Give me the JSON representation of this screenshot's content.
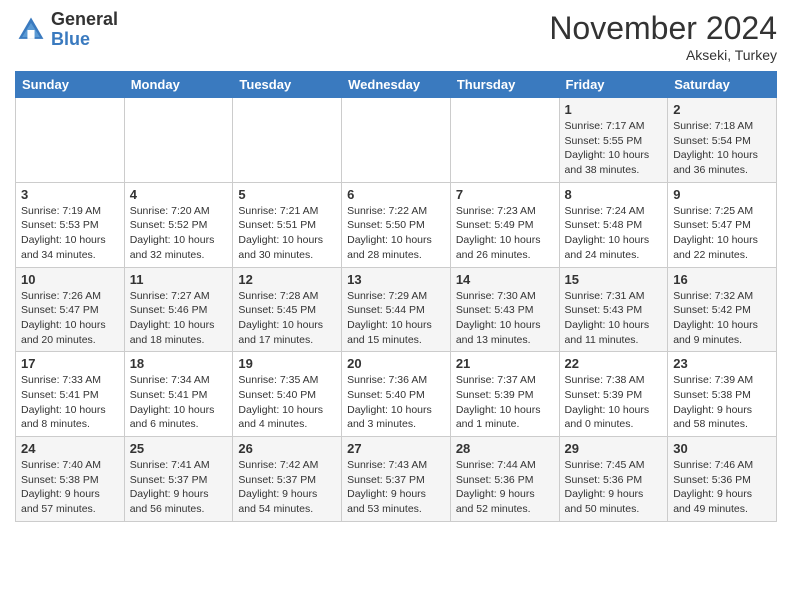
{
  "logo": {
    "general": "General",
    "blue": "Blue"
  },
  "header": {
    "month": "November 2024",
    "location": "Akseki, Turkey"
  },
  "days_of_week": [
    "Sunday",
    "Monday",
    "Tuesday",
    "Wednesday",
    "Thursday",
    "Friday",
    "Saturday"
  ],
  "weeks": [
    [
      {
        "day": "",
        "info": ""
      },
      {
        "day": "",
        "info": ""
      },
      {
        "day": "",
        "info": ""
      },
      {
        "day": "",
        "info": ""
      },
      {
        "day": "",
        "info": ""
      },
      {
        "day": "1",
        "info": "Sunrise: 7:17 AM\nSunset: 5:55 PM\nDaylight: 10 hours and 38 minutes."
      },
      {
        "day": "2",
        "info": "Sunrise: 7:18 AM\nSunset: 5:54 PM\nDaylight: 10 hours and 36 minutes."
      }
    ],
    [
      {
        "day": "3",
        "info": "Sunrise: 7:19 AM\nSunset: 5:53 PM\nDaylight: 10 hours and 34 minutes."
      },
      {
        "day": "4",
        "info": "Sunrise: 7:20 AM\nSunset: 5:52 PM\nDaylight: 10 hours and 32 minutes."
      },
      {
        "day": "5",
        "info": "Sunrise: 7:21 AM\nSunset: 5:51 PM\nDaylight: 10 hours and 30 minutes."
      },
      {
        "day": "6",
        "info": "Sunrise: 7:22 AM\nSunset: 5:50 PM\nDaylight: 10 hours and 28 minutes."
      },
      {
        "day": "7",
        "info": "Sunrise: 7:23 AM\nSunset: 5:49 PM\nDaylight: 10 hours and 26 minutes."
      },
      {
        "day": "8",
        "info": "Sunrise: 7:24 AM\nSunset: 5:48 PM\nDaylight: 10 hours and 24 minutes."
      },
      {
        "day": "9",
        "info": "Sunrise: 7:25 AM\nSunset: 5:47 PM\nDaylight: 10 hours and 22 minutes."
      }
    ],
    [
      {
        "day": "10",
        "info": "Sunrise: 7:26 AM\nSunset: 5:47 PM\nDaylight: 10 hours and 20 minutes."
      },
      {
        "day": "11",
        "info": "Sunrise: 7:27 AM\nSunset: 5:46 PM\nDaylight: 10 hours and 18 minutes."
      },
      {
        "day": "12",
        "info": "Sunrise: 7:28 AM\nSunset: 5:45 PM\nDaylight: 10 hours and 17 minutes."
      },
      {
        "day": "13",
        "info": "Sunrise: 7:29 AM\nSunset: 5:44 PM\nDaylight: 10 hours and 15 minutes."
      },
      {
        "day": "14",
        "info": "Sunrise: 7:30 AM\nSunset: 5:43 PM\nDaylight: 10 hours and 13 minutes."
      },
      {
        "day": "15",
        "info": "Sunrise: 7:31 AM\nSunset: 5:43 PM\nDaylight: 10 hours and 11 minutes."
      },
      {
        "day": "16",
        "info": "Sunrise: 7:32 AM\nSunset: 5:42 PM\nDaylight: 10 hours and 9 minutes."
      }
    ],
    [
      {
        "day": "17",
        "info": "Sunrise: 7:33 AM\nSunset: 5:41 PM\nDaylight: 10 hours and 8 minutes."
      },
      {
        "day": "18",
        "info": "Sunrise: 7:34 AM\nSunset: 5:41 PM\nDaylight: 10 hours and 6 minutes."
      },
      {
        "day": "19",
        "info": "Sunrise: 7:35 AM\nSunset: 5:40 PM\nDaylight: 10 hours and 4 minutes."
      },
      {
        "day": "20",
        "info": "Sunrise: 7:36 AM\nSunset: 5:40 PM\nDaylight: 10 hours and 3 minutes."
      },
      {
        "day": "21",
        "info": "Sunrise: 7:37 AM\nSunset: 5:39 PM\nDaylight: 10 hours and 1 minute."
      },
      {
        "day": "22",
        "info": "Sunrise: 7:38 AM\nSunset: 5:39 PM\nDaylight: 10 hours and 0 minutes."
      },
      {
        "day": "23",
        "info": "Sunrise: 7:39 AM\nSunset: 5:38 PM\nDaylight: 9 hours and 58 minutes."
      }
    ],
    [
      {
        "day": "24",
        "info": "Sunrise: 7:40 AM\nSunset: 5:38 PM\nDaylight: 9 hours and 57 minutes."
      },
      {
        "day": "25",
        "info": "Sunrise: 7:41 AM\nSunset: 5:37 PM\nDaylight: 9 hours and 56 minutes."
      },
      {
        "day": "26",
        "info": "Sunrise: 7:42 AM\nSunset: 5:37 PM\nDaylight: 9 hours and 54 minutes."
      },
      {
        "day": "27",
        "info": "Sunrise: 7:43 AM\nSunset: 5:37 PM\nDaylight: 9 hours and 53 minutes."
      },
      {
        "day": "28",
        "info": "Sunrise: 7:44 AM\nSunset: 5:36 PM\nDaylight: 9 hours and 52 minutes."
      },
      {
        "day": "29",
        "info": "Sunrise: 7:45 AM\nSunset: 5:36 PM\nDaylight: 9 hours and 50 minutes."
      },
      {
        "day": "30",
        "info": "Sunrise: 7:46 AM\nSunset: 5:36 PM\nDaylight: 9 hours and 49 minutes."
      }
    ]
  ]
}
